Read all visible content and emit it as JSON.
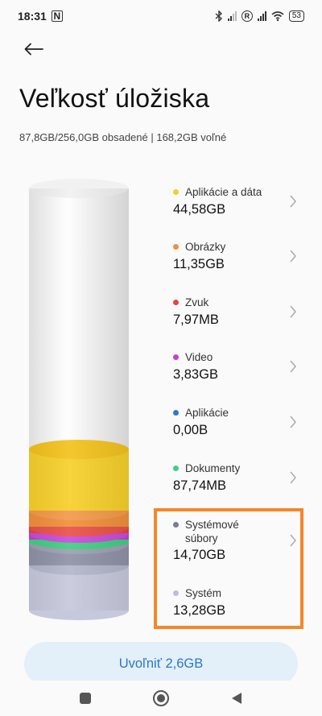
{
  "status_bar": {
    "time": "18:31",
    "nfc_glyph": "N",
    "roaming_glyph": "R",
    "battery": "53"
  },
  "page": {
    "title": "Veľkosť úložiska",
    "summary": "87,8GB/256,0GB obsadené | 168,2GB voľné"
  },
  "storage": {
    "total_gb": 256.0,
    "used_gb": 87.8,
    "free_gb": 168.2
  },
  "categories": [
    {
      "label": "Aplikácie a dáta",
      "value": "44,58GB",
      "color": "#f6cd2a"
    },
    {
      "label": "Obrázky",
      "value": "11,35GB",
      "color": "#f18f3b"
    },
    {
      "label": "Zvuk",
      "value": "7,97MB",
      "color": "#e8443b"
    },
    {
      "label": "Video",
      "value": "3,83GB",
      "color": "#c53fd6"
    },
    {
      "label": "Aplikácie",
      "value": "0,00B",
      "color": "#2a78d2"
    },
    {
      "label": "Dokumenty",
      "value": "87,74MB",
      "color": "#3fcf7f"
    },
    {
      "label": "Systémové\nsúbory",
      "value": "14,70GB",
      "color": "#7a7d90"
    },
    {
      "label": "Systém",
      "value": "13,28GB",
      "color": "#bcbfd4"
    }
  ],
  "actions": {
    "free_up_label": "Uvoľniť 2,6GB"
  },
  "colors": {
    "highlight": "#f5862a",
    "accent": "#2b78c2",
    "button_bg": "#e3eff9"
  },
  "icons": [
    "back-arrow-icon",
    "chevron-right-icon",
    "nav-square-icon",
    "nav-home-icon",
    "nav-back-icon"
  ]
}
